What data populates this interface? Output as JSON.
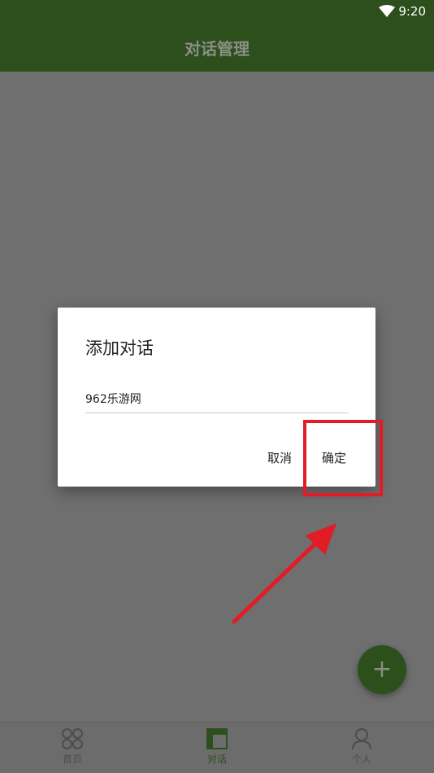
{
  "status_bar": {
    "time": "9:20",
    "wifi_icon": "wifi-icon"
  },
  "app_bar": {
    "title": "对话管理"
  },
  "dialog": {
    "title": "添加对话",
    "input_value": "962乐游网",
    "cancel_label": "取消",
    "confirm_label": "确定"
  },
  "fab": {
    "label": "+"
  },
  "bottom_nav": {
    "items": [
      {
        "label": "首页",
        "icon": "grid-icon"
      },
      {
        "label": "对话",
        "icon": "layout-icon",
        "active": true
      },
      {
        "label": "个人",
        "icon": "person-icon"
      }
    ]
  },
  "colors": {
    "primary": "#2d4f1c",
    "overlay": "#6f6f6f",
    "highlight": "#e21b24"
  }
}
